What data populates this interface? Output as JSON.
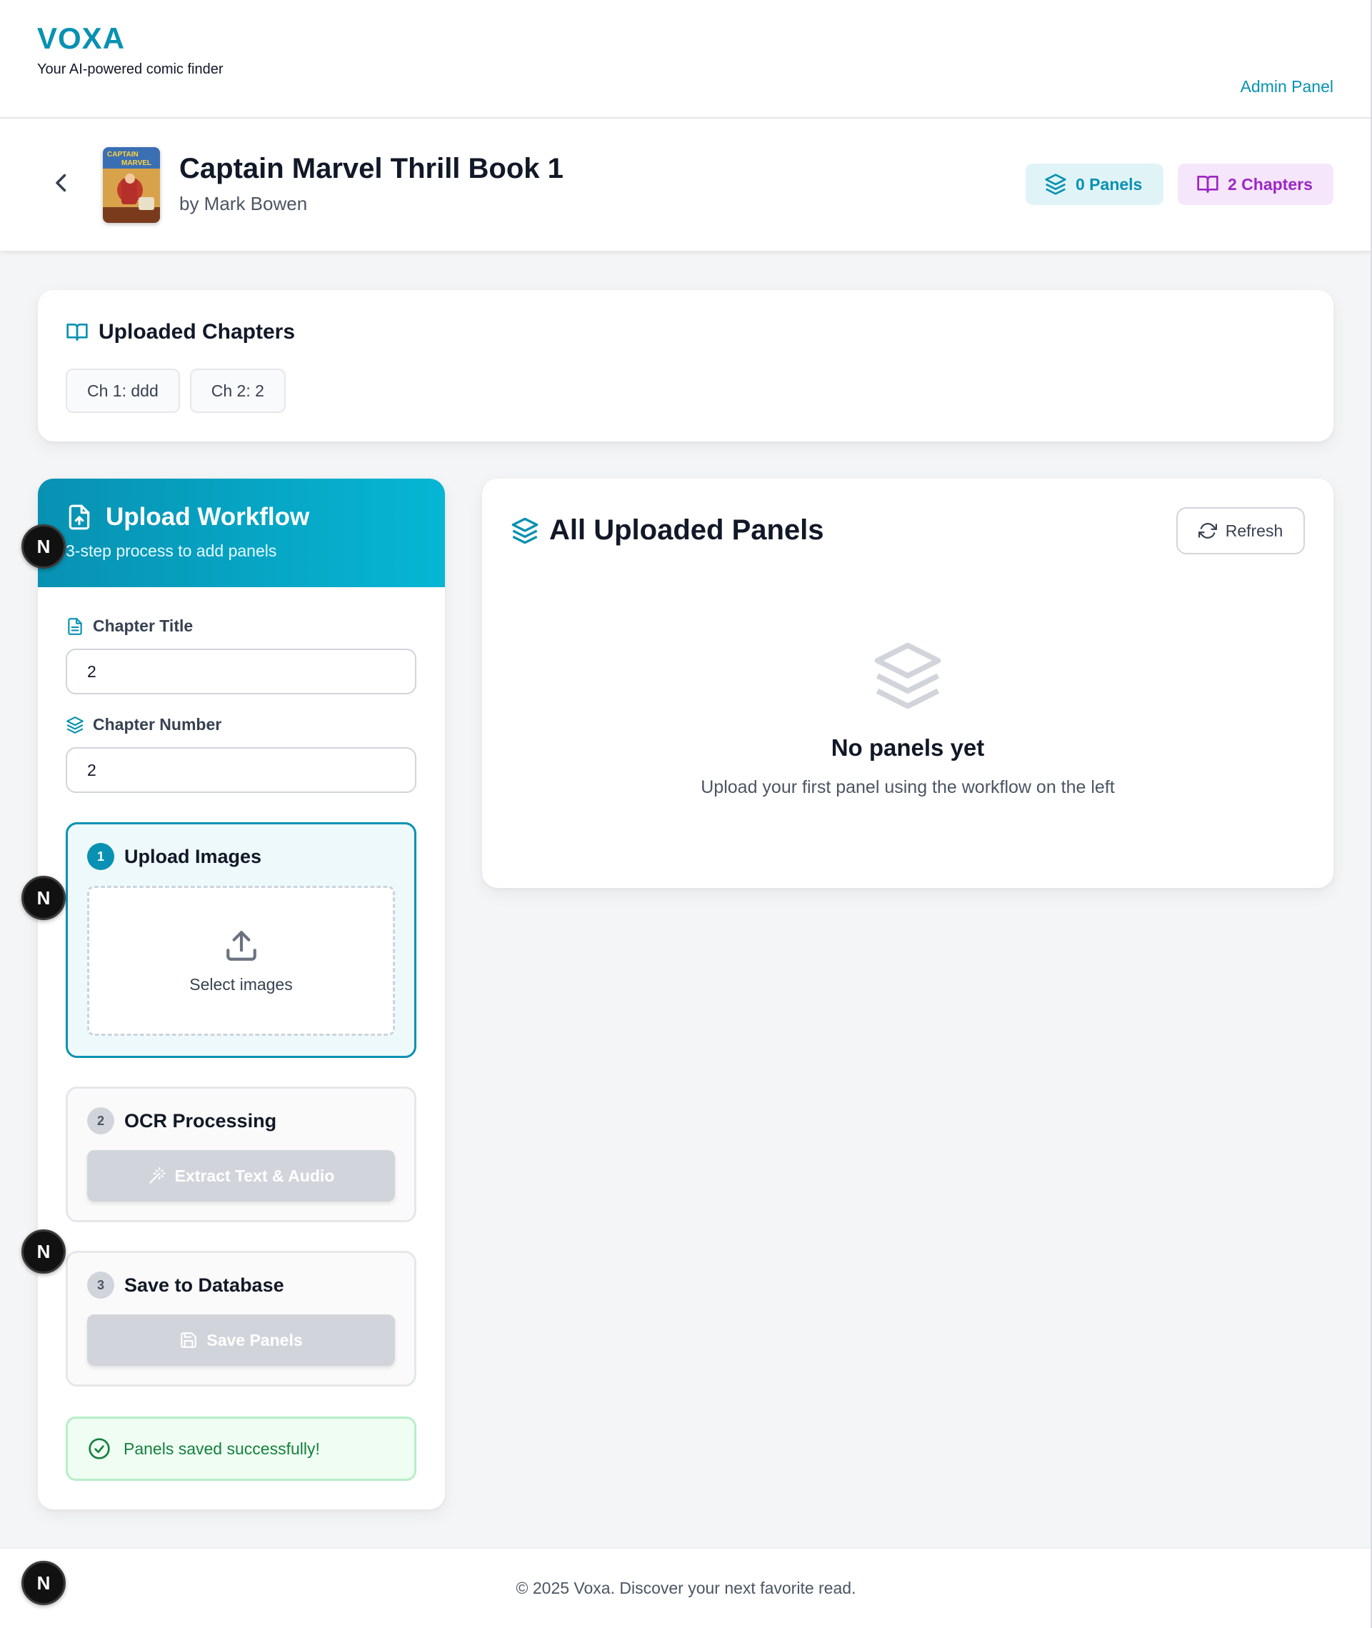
{
  "brand": {
    "name": "VOXA",
    "tagline": "Your AI-powered comic finder",
    "admin_link": "Admin Panel"
  },
  "book": {
    "title": "Captain Marvel Thrill Book 1",
    "author": "by Mark Bowen",
    "cover_text": [
      "CAPTAIN",
      "MARVEL"
    ],
    "panels_badge": "0 Panels",
    "chapters_badge": "2 Chapters"
  },
  "uploaded_chapters": {
    "heading": "Uploaded Chapters",
    "chips": [
      "Ch 1: ddd",
      "Ch 2: 2"
    ]
  },
  "workflow": {
    "title": "Upload Workflow",
    "subtitle": "3-step process to add panels",
    "chapter_title_label": "Chapter Title",
    "chapter_title_value": "2",
    "chapter_number_label": "Chapter Number",
    "chapter_number_value": "2",
    "steps": [
      {
        "number": "1",
        "title": "Upload Images",
        "action": "Select images"
      },
      {
        "number": "2",
        "title": "OCR Processing",
        "action": "Extract Text & Audio"
      },
      {
        "number": "3",
        "title": "Save to Database",
        "action": "Save Panels"
      }
    ],
    "success_message": "Panels saved successfully!"
  },
  "panels": {
    "heading": "All Uploaded Panels",
    "refresh_label": "Refresh",
    "empty_title": "No panels yet",
    "empty_subtitle": "Upload your first panel using the workflow on the left"
  },
  "footer": {
    "text": "© 2025 Voxa. Discover your next favorite read."
  },
  "floating_badge_letter": "N",
  "colors": {
    "accent": "#0891b2",
    "accent_light": "#06b6d4",
    "purple": "#9b27c4",
    "success": "#15803d",
    "disabled": "#d1d5db"
  },
  "icons": {
    "back": "chevron-left-icon",
    "panels": "layers-icon",
    "chapters": "book-open-icon",
    "upload_workflow": "file-upload-icon",
    "chapter_title": "file-text-icon",
    "chapter_number": "layers-icon",
    "upload": "upload-icon",
    "ocr": "magic-wand-icon",
    "save": "save-icon",
    "success": "check-circle-icon",
    "refresh": "refresh-icon"
  }
}
